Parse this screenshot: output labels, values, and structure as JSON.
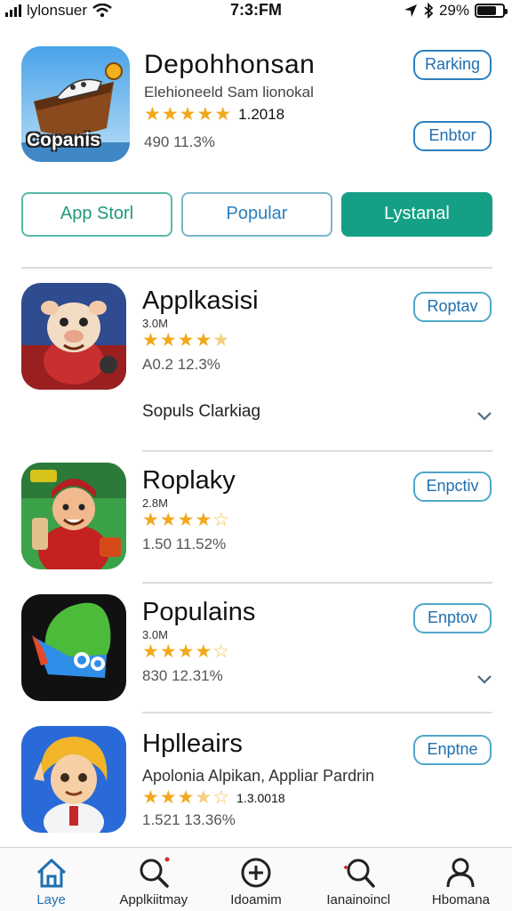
{
  "status_bar": {
    "carrier": "lylonsuer",
    "time": "7:3:FM",
    "battery": "29%",
    "battery_level": 0.75
  },
  "featured": {
    "title": "Depohhonsan",
    "subtitle": "Elehioneeld Sam lionokal",
    "icon_text": "Copanis",
    "rating_text": "1.2018",
    "rating": 5,
    "meta": "490 11.3%",
    "ranking_button": "Rarking",
    "enbtor_button": "Enbtor"
  },
  "segments": [
    "App Storl",
    "Popular",
    "Lystanal"
  ],
  "section_label": "Sopuls Clarkiag",
  "apps": [
    {
      "name": "Applkasisi",
      "size": "3.0M",
      "rating": 4.5,
      "meta": "A0.2 12.3%",
      "button": "Roptav",
      "icon": "cartoon-pig-icon"
    },
    {
      "name": "Roplaky",
      "size": "2.8M",
      "rating": 4,
      "meta": "1.50 11.52%",
      "button": "Enpctiv",
      "icon": "cartoon-chef-icon"
    },
    {
      "name": "Populains",
      "size": "3.0M",
      "rating": 4,
      "meta": "830 12.31%",
      "button": "Enptov",
      "icon": "leaf-logo-icon"
    },
    {
      "name": "Hplleairs",
      "description": "Apolonia Alpikan, Appliar Pardrin",
      "rating_text": "1.3.0018",
      "rating": 3.5,
      "meta": "1.521 13.36%",
      "button": "Enptne",
      "icon": "cartoon-girl-icon"
    }
  ],
  "bottom_nav": [
    {
      "label": "Laye",
      "icon": "home-icon",
      "active": true
    },
    {
      "label": "Applkiitmay",
      "icon": "search-icon",
      "active": false
    },
    {
      "label": "Idoamim",
      "icon": "add-icon",
      "active": false
    },
    {
      "label": "Ianainoincl",
      "icon": "search-sparkle-icon",
      "active": false
    },
    {
      "label": "Hbomana",
      "icon": "profile-icon",
      "active": false
    }
  ],
  "colors": {
    "accent": "#15a085",
    "link_blue": "#1f6fb0",
    "star": "#f1a91b"
  }
}
